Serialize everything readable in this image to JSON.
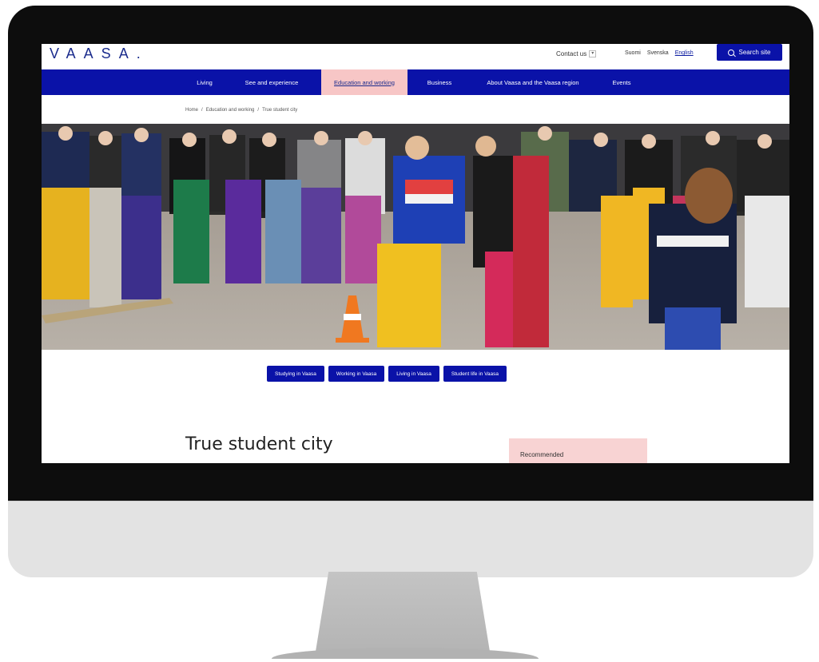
{
  "site": {
    "logo": "VAASA.",
    "contact_label": "Contact us",
    "languages": [
      "Suomi",
      "Svenska",
      "English"
    ],
    "active_language": "English",
    "search_label": "Search site"
  },
  "nav": {
    "items": [
      {
        "label": "Living"
      },
      {
        "label": "See and experience"
      },
      {
        "label": "Education and working",
        "active": true
      },
      {
        "label": "Business"
      },
      {
        "label": "About Vaasa and the Vaasa region"
      },
      {
        "label": "Events"
      }
    ]
  },
  "breadcrumb": [
    "Home",
    "/",
    "Education and working",
    "/",
    "True student city"
  ],
  "subnav": {
    "buttons": [
      "Studying in Vaasa",
      "Working in Vaasa",
      "Living in Vaasa",
      "Student life in Vaasa"
    ]
  },
  "page": {
    "title": "True student city",
    "recommended_label": "Recommended"
  },
  "colors": {
    "brand_blue": "#0a12a8",
    "active_pink": "#f7c6c6",
    "recommended_pink": "#f8d3d3",
    "bezel": "#0d0d0d",
    "chin": "#e3e3e3"
  }
}
